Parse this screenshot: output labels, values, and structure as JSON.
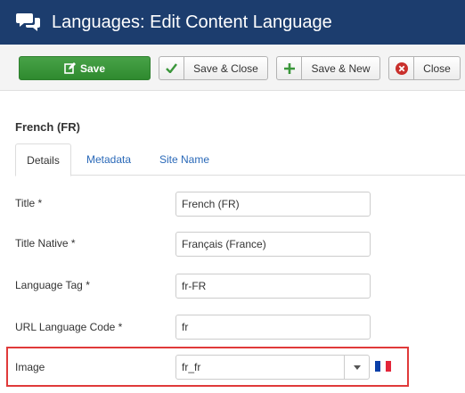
{
  "header": {
    "title": "Languages: Edit Content Language",
    "logo_icon": "speech-bubbles-icon"
  },
  "toolbar": {
    "save_label": "Save",
    "save_close_label": "Save & Close",
    "save_new_label": "Save & New",
    "close_label": "Close",
    "save_icon": "edit-icon",
    "save_close_icon": "check-icon",
    "save_new_icon": "plus-icon",
    "close_icon": "close-circle-icon"
  },
  "item_heading": "French (FR)",
  "tabs": [
    {
      "label": "Details",
      "active": true
    },
    {
      "label": "Metadata",
      "active": false
    },
    {
      "label": "Site Name",
      "active": false
    }
  ],
  "form": {
    "title": {
      "label": "Title *",
      "value": "French (FR)"
    },
    "title_native": {
      "label": "Title Native *",
      "value": "Français (France)"
    },
    "language_tag": {
      "label": "Language Tag *",
      "value": "fr-FR"
    },
    "url_code": {
      "label": "URL Language Code *",
      "value": "fr"
    },
    "image": {
      "label": "Image",
      "value": "fr_fr",
      "flag_icon": "france-flag-icon"
    }
  },
  "colors": {
    "header_bg": "#1c3d6e",
    "save_green": "#3a963a",
    "link_blue": "#2a69b8",
    "highlight_red": "#e03a3a",
    "flag_blue": "#0a3fa8",
    "flag_red": "#e3263a"
  }
}
